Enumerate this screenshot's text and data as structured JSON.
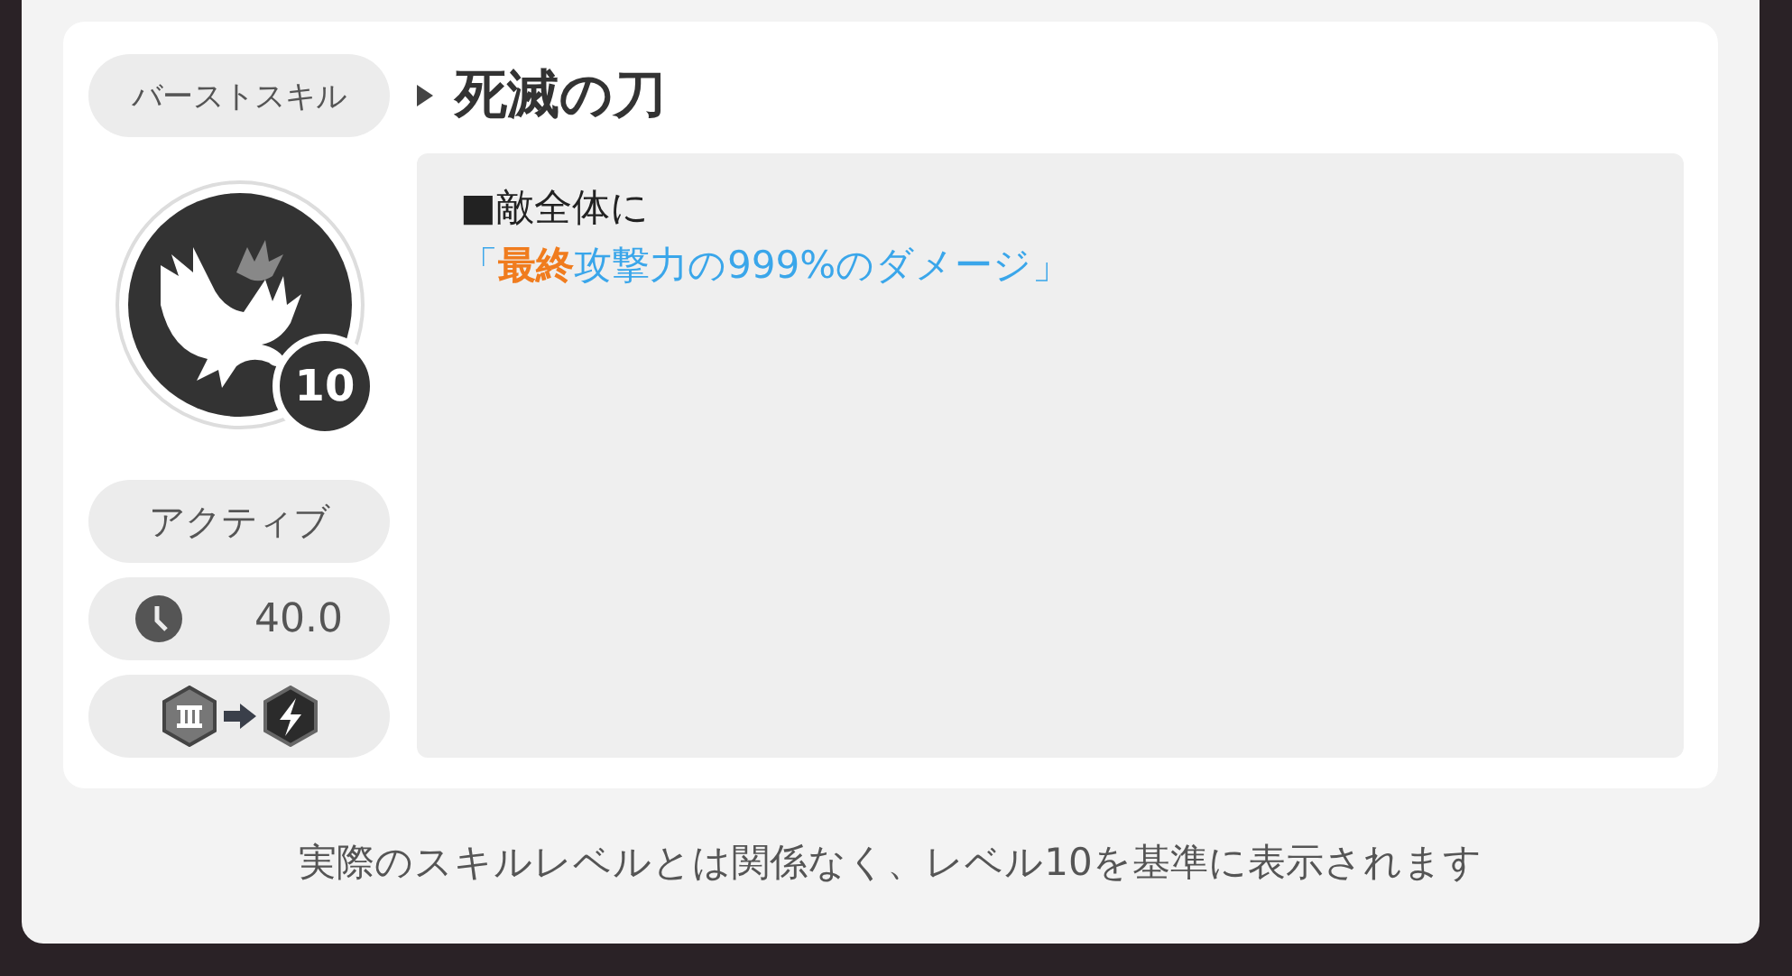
{
  "skill": {
    "category": "バーストスキル",
    "name": "死滅の刀",
    "level": "10",
    "type": "アクティブ",
    "cooldown": "40.0",
    "description": [
      {
        "segments": [
          {
            "text": "■敵全体に",
            "kind": "plain"
          }
        ]
      },
      {
        "segments": [
          {
            "text": "「",
            "kind": "value"
          },
          {
            "text": "最終",
            "kind": "emphasis"
          },
          {
            "text": "攻撃力の999%のダメージ」",
            "kind": "value"
          }
        ]
      }
    ]
  },
  "footnote": "実際のスキルレベルとは関係なく、レベル10を基準に表示されます"
}
